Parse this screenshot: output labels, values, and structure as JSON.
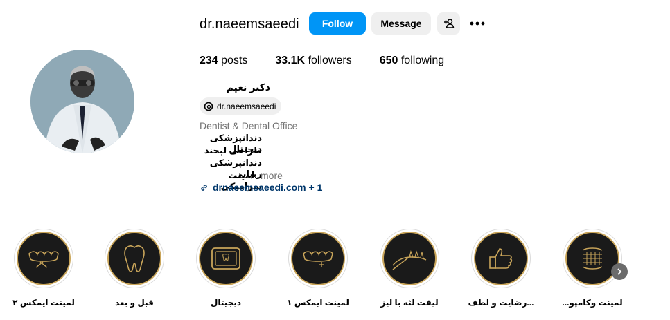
{
  "profile": {
    "username": "dr.naeemsaeedi",
    "full_name": "دکتر نعیم سعیدی",
    "threads_handle": "dr.naeemsaeedi",
    "category": "Dentist & Dental Office",
    "bio_lines": [
      "دندانپزشکی دیجیتال",
      "طراحی لبخند",
      "دندانپزشکی زیبایی",
      "...لمینت سرامیکی"
    ],
    "bio_more": "more",
    "link": "drnaeemsaeedi.com + 1"
  },
  "buttons": {
    "follow": "Follow",
    "message": "Message"
  },
  "stats": {
    "posts_count": "234",
    "posts_label": "posts",
    "followers_count": "33.1K",
    "followers_label": "followers",
    "following_count": "650",
    "following_label": "following"
  },
  "highlights": [
    {
      "label": "لمینت ایمکس ۲",
      "icon": "veneer-teeth-icon"
    },
    {
      "label": "قبل و بعد",
      "icon": "tooth-icon"
    },
    {
      "label": "دیجیتال",
      "icon": "digital-tablet-icon"
    },
    {
      "label": "لمینت ایمکس ۱",
      "icon": "veneer-teeth-icon"
    },
    {
      "label": "لیفت لثه با لیز",
      "icon": "gum-laser-icon"
    },
    {
      "label": "...رضایت و لطف",
      "icon": "thumbs-up-icon"
    },
    {
      "label": "لمینت وکامپو...",
      "icon": "teeth-set-icon"
    }
  ],
  "colors": {
    "accent": "#0095f6",
    "highlight_gold": "#c9a55a",
    "link": "#00376b"
  }
}
